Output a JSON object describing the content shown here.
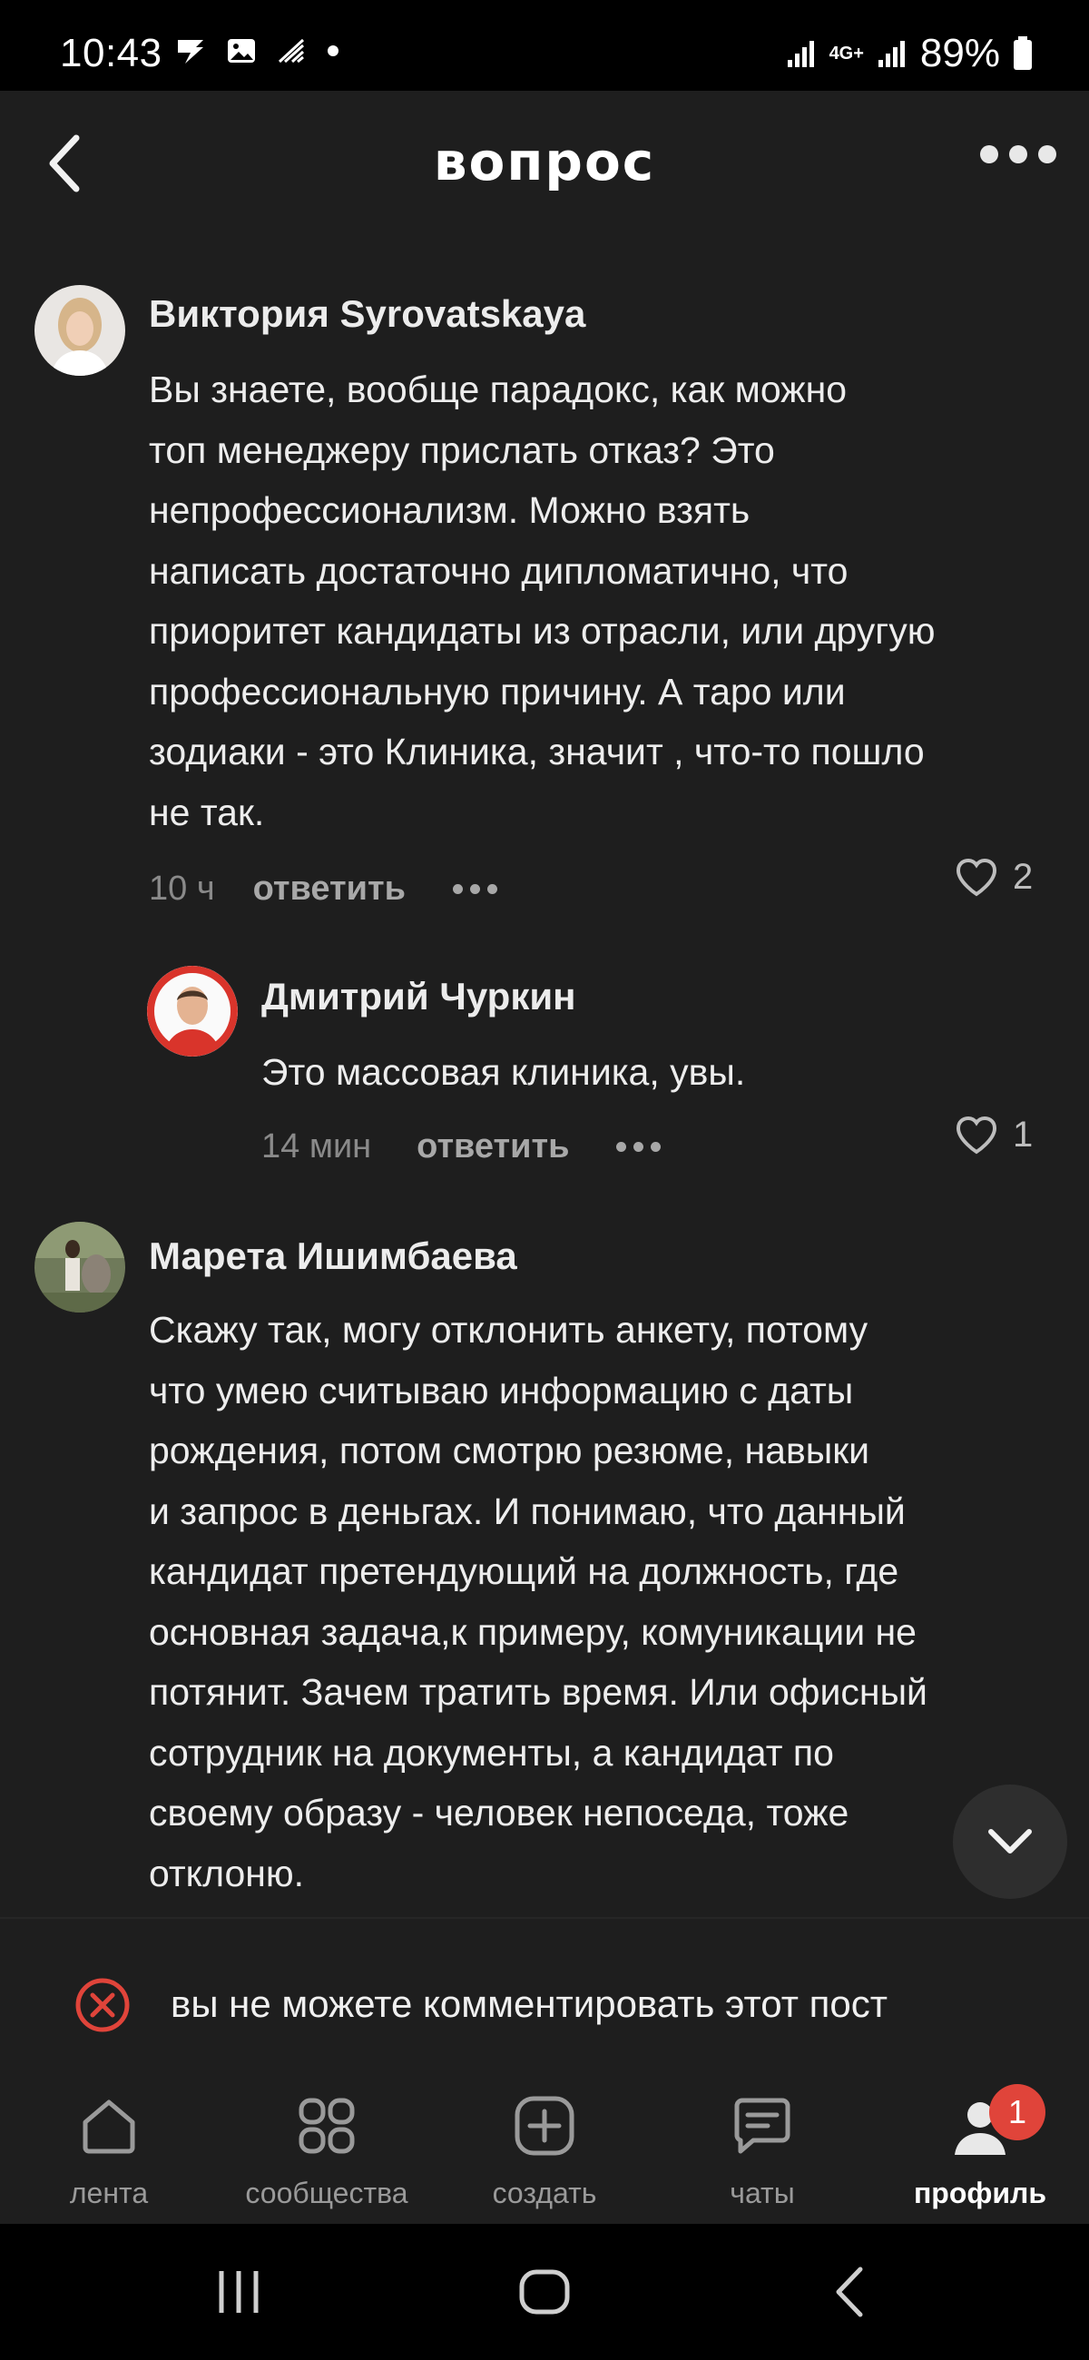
{
  "status_bar": {
    "time": "10:43",
    "battery": "89%",
    "network": "4G+"
  },
  "header": {
    "title": "вопрос"
  },
  "comments": [
    {
      "author": "Виктория Syrovatskaya",
      "lines": [
        "Вы знаете, вообще парадокс, как можно",
        "топ менеджеру прислать отказ? Это",
        "непрофессионализм. Можно взять",
        "написать достаточно дипломатично, что",
        "приоритет кандидаты из отрасли, или другую",
        "профессиональную причину. А таро или",
        "зодиаки - это Клиника, значит , что-то пошло",
        "не так."
      ],
      "time": "10 ч",
      "reply_label": "ответить",
      "likes": "2"
    },
    {
      "author": "Дмитрий Чуркин",
      "lines": [
        "Это массовая клиника, увы."
      ],
      "time": "14 мин",
      "reply_label": "ответить",
      "likes": "1"
    },
    {
      "author": "Марета Ишимбаева",
      "lines": [
        "Скажу так, могу отклонить анкету, потому",
        "что умею считываю информацию с даты",
        "рождения, потом смотрю  резюме, навыки",
        "и запрос в деньгах. И понимаю, что данный",
        "кандидат претендующий на должность, где",
        "основная задача,к примеру, комуникации не",
        "потянит. Зачем тратить время. Или офисный",
        "сотрудник на документы, а кандидат   по",
        "своему образу - человек непоседа, тоже",
        "отклоню."
      ]
    }
  ],
  "notice": {
    "text": "вы не можете комментировать этот пост"
  },
  "bottom_nav": {
    "items": [
      {
        "label": "лента",
        "icon": "home-icon"
      },
      {
        "label": "сообщества",
        "icon": "grid-icon"
      },
      {
        "label": "создать",
        "icon": "plus-square-icon"
      },
      {
        "label": "чаты",
        "icon": "chat-icon"
      },
      {
        "label": "профиль",
        "icon": "profile-icon",
        "active": true
      }
    ],
    "profile_badge": "1"
  }
}
